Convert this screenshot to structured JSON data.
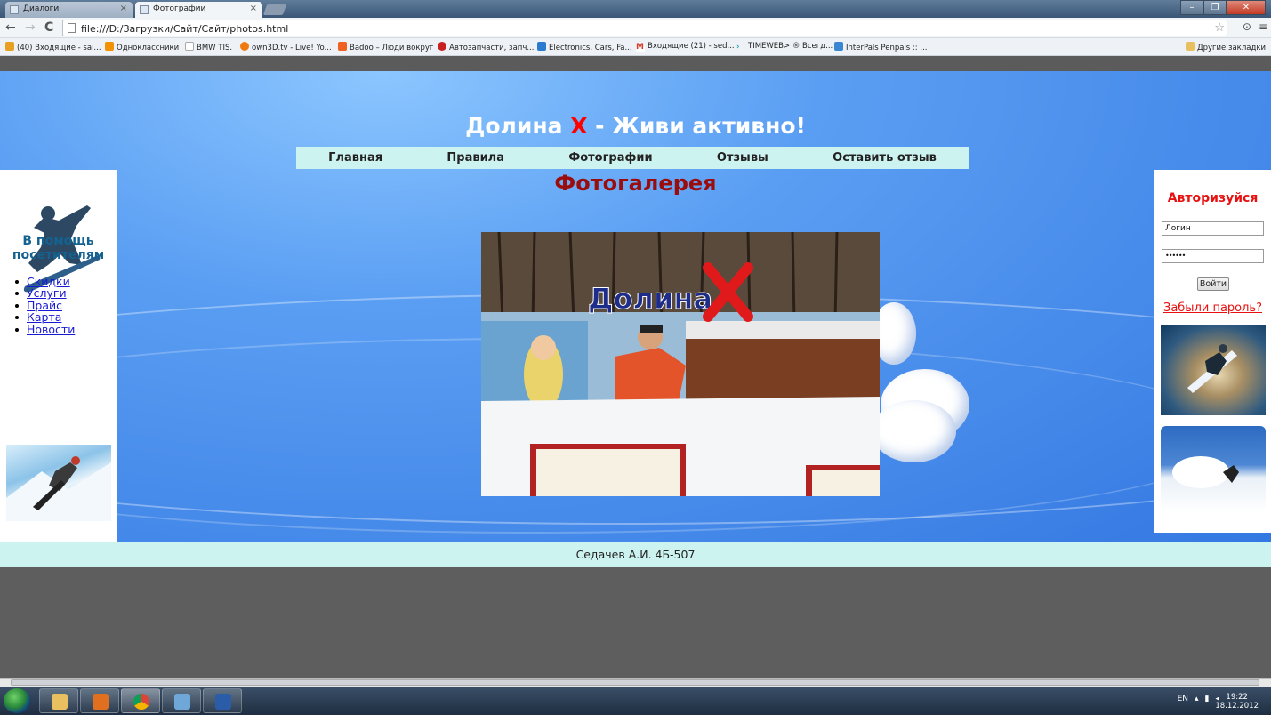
{
  "browser": {
    "tabs": [
      {
        "label": "Диалоги",
        "close": "×"
      },
      {
        "label": "Фотографии",
        "close": "×"
      }
    ],
    "nav": {
      "back": "←",
      "forward": "→",
      "reload": "C"
    },
    "url": "file:///D:/Загрузки/Сайт/Сайт/photos.html",
    "star": "☆",
    "window_controls": [
      "–",
      "❐",
      "✕"
    ],
    "bookmarks": [
      {
        "label": "(40) Входящие - sai...",
        "color": "#e8a020"
      },
      {
        "label": "Одноклассники",
        "color": "#f39200"
      },
      {
        "label": "BMW TIS.",
        "color": "#cccccc"
      },
      {
        "label": "own3D.tv - Live! Yo...",
        "color": "#f07a10"
      },
      {
        "label": "Badoo – Люди вокруг",
        "color": "#f06020"
      },
      {
        "label": "Автозапчасти, запч...",
        "color": "#c82020"
      },
      {
        "label": "Electronics, Cars, Fa...",
        "color": "#2a7ad0"
      },
      {
        "label": "Входящие (21) - sed...",
        "color": "#d33a2c"
      },
      {
        "label": "TIMEWEB> ® Всегд...",
        "color": "#18a0a8"
      },
      {
        "label": "InterPals Penpals :: ...",
        "color": "#3a86d0"
      }
    ],
    "other_bookmarks": "Другие закладки"
  },
  "site": {
    "title_part1": "Долина ",
    "title_x": "X",
    "title_part2": " - Живи активно!",
    "menu": [
      "Главная",
      "Правила",
      "Фотографии",
      "Отзывы",
      "Оставить отзыв"
    ],
    "gallery_title": "Фотогалерея",
    "left": {
      "heading": "В помощь посетителям",
      "links": [
        "Скидки",
        "Услуги",
        "Прайс",
        "Карта",
        "Новости"
      ]
    },
    "auth": {
      "heading": "Авторизуйся",
      "login_value": "Логин",
      "password_value": "••••••",
      "button": "Войти",
      "forgot": "Забыли пароль?"
    },
    "photo_logo": "Долина",
    "footer": "Седачев А.И. 4Б-507"
  },
  "taskbar": {
    "lang": "EN",
    "time": "19:22",
    "date": "18.12.2012"
  }
}
